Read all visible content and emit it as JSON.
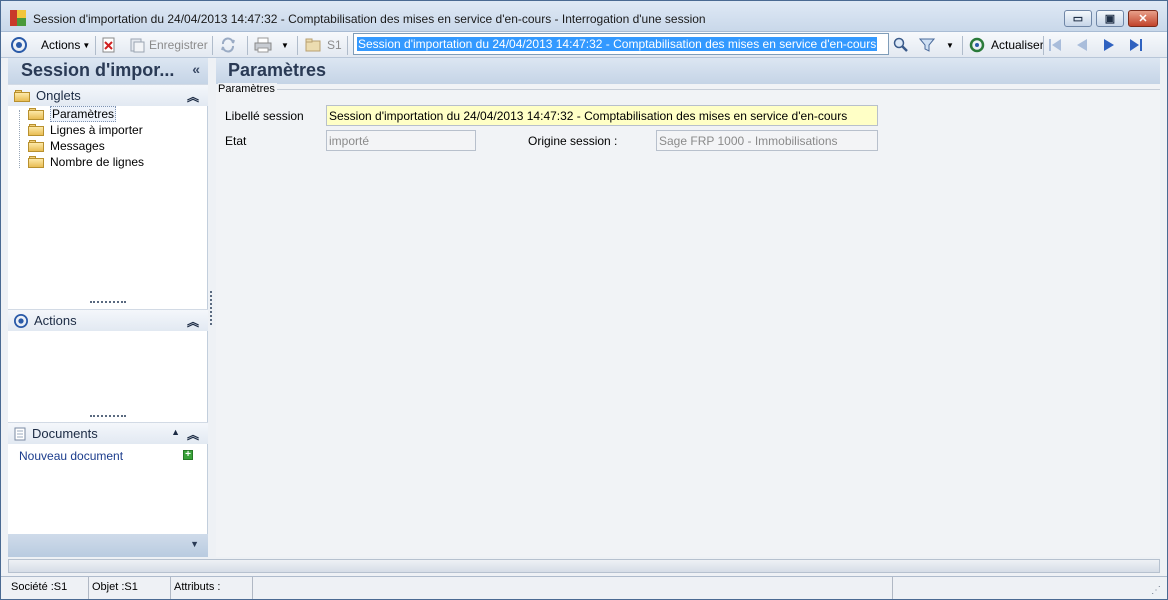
{
  "window": {
    "title": "Session d'importation du 24/04/2013 14:47:32 - Comptabilisation des mises en service d'en-cours -  Interrogation d'une session",
    "min_glyph": "▭",
    "max_glyph": "▣",
    "close_glyph": "✕"
  },
  "toolbar": {
    "actions_label": "Actions",
    "save_label": "Enregistrer",
    "s1_label": "S1",
    "search_value": "Session d'importation du 24/04/2013 14:47:32 - Comptabilisation des mises en service d'en-cours",
    "refresh_label": "Actualiser"
  },
  "left": {
    "title": "Session d'impor...",
    "collapse_glyph": "«",
    "onglets": {
      "title": "Onglets",
      "items": [
        {
          "label": "Paramètres"
        },
        {
          "label": "Lignes à importer"
        },
        {
          "label": "Messages"
        },
        {
          "label": "Nombre de lignes"
        }
      ]
    },
    "actions": {
      "title": "Actions"
    },
    "documents": {
      "title": "Documents",
      "new_doc_label": "Nouveau document"
    }
  },
  "main": {
    "title": "Paramètres",
    "group_title": "Paramètres",
    "fields": {
      "libelle_label": "Libellé session",
      "libelle_value": "Session d'importation du 24/04/2013 14:47:32 - Comptabilisation des mises en service d'en-cours",
      "etat_label": "Etat",
      "etat_value": "importé",
      "origine_label": "Origine session :",
      "origine_value": "Sage FRP 1000 - Immobilisations"
    }
  },
  "status": {
    "societe": "Société :S1",
    "objet": "Objet :S1",
    "attributs": "Attributs :"
  },
  "colors": {
    "accent": "#2a3a55",
    "field_highlight": "#ffffc6",
    "selection": "#3399ff"
  }
}
